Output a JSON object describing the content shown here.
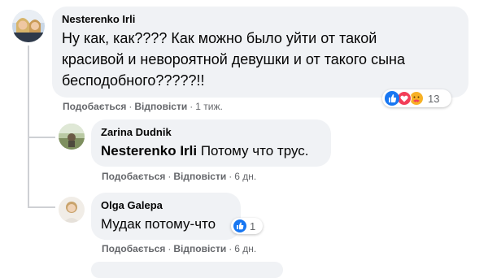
{
  "comments": [
    {
      "author": "Nesterenko Irli",
      "text_lines": [
        "Ну как, как???? Как можно было уйти от такой",
        "красивой и невороятной девушки и от такого сына",
        "бесподобного?????!!"
      ],
      "actions": {
        "like": "Подобається",
        "reply": "Відповісти",
        "time": "1 тиж."
      },
      "reactions": {
        "icons": [
          "like-icon",
          "love-icon",
          "care-icon"
        ],
        "count": "13"
      }
    },
    {
      "author": "Zarina Dudnik",
      "mention": "Nesterenko Irli",
      "text": " Потому что трус.",
      "actions": {
        "like": "Подобається",
        "reply": "Відповісти",
        "time": "6 дн."
      }
    },
    {
      "author": "Olga Galepa",
      "text": "Мудак потому-что",
      "actions": {
        "like": "Подобається",
        "reply": "Відповісти",
        "time": "6 дн."
      },
      "reactions": {
        "icons": [
          "like-icon"
        ],
        "count": "1"
      }
    }
  ],
  "colors": {
    "bubble": "#f0f2f5",
    "meta_text": "#65676b",
    "like_blue": "#1877f2",
    "love_red": "#f33e58",
    "care_yellow": "#f7b125"
  }
}
